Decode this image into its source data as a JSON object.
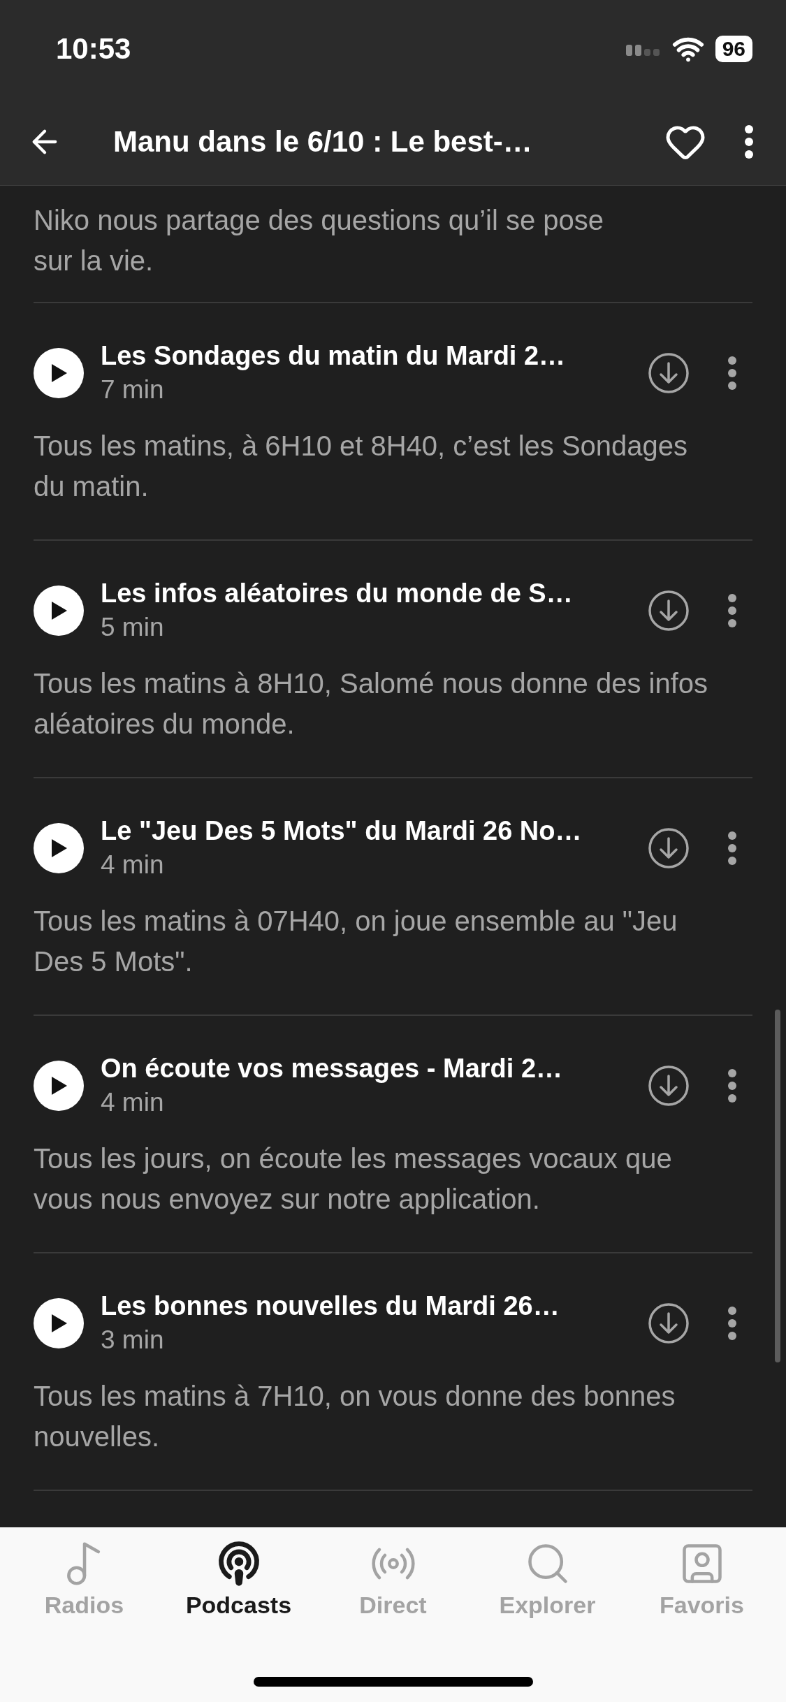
{
  "status_bar": {
    "time": "10:53",
    "battery": "96"
  },
  "header": {
    "title": "Manu dans le 6/10 : Le best-…",
    "favorite": false
  },
  "intro": {
    "description": "Niko nous partage des questions qu’il se pose sur la vie."
  },
  "episodes": [
    {
      "title": "Les Sondages du matin du Mardi 2…",
      "duration": "7 min",
      "description": "Tous les matins, à 6H10 et 8H40, c’est les Sondages du matin."
    },
    {
      "title": "Les infos aléatoires du monde de S…",
      "duration": "5 min",
      "description": "Tous les matins à 8H10, Salomé nous donne des infos aléatoires du monde."
    },
    {
      "title": "Le \"Jeu Des 5 Mots\" du Mardi 26 No…",
      "duration": "4 min",
      "description": "Tous les matins à 07H40, on joue ensemble au \"Jeu Des 5 Mots\"."
    },
    {
      "title": "On écoute vos messages - Mardi 2…",
      "duration": "4 min",
      "description": "Tous les jours, on écoute les messages vocaux que vous nous envoyez sur notre application."
    },
    {
      "title": "Les bonnes nouvelles du Mardi 26…",
      "duration": "3 min",
      "description": "Tous les matins à 7H10, on vous donne des bonnes nouvelles."
    }
  ],
  "tab_bar": [
    {
      "kind": "radios",
      "label": "Radios",
      "selected": false
    },
    {
      "kind": "podcasts",
      "label": "Podcasts",
      "selected": true
    },
    {
      "kind": "direct",
      "label": "Direct",
      "selected": false
    },
    {
      "kind": "explorer",
      "label": "Explorer",
      "selected": false
    },
    {
      "kind": "favoris",
      "label": "Favoris",
      "selected": false
    }
  ]
}
